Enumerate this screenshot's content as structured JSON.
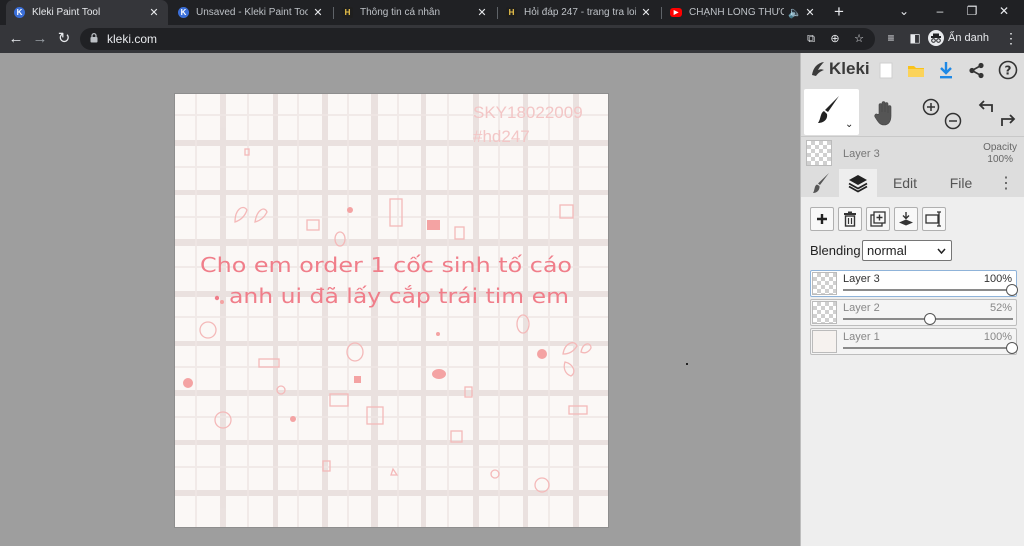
{
  "browser": {
    "tabs": [
      {
        "title": "Kleki Paint Tool",
        "active": true,
        "icon": "kleki-icon"
      },
      {
        "title": "Unsaved - Kleki Paint Tool",
        "active": false,
        "icon": "kleki-icon"
      },
      {
        "title": "Thông tin cá nhân",
        "active": false,
        "icon": "hoidap247-icon"
      },
      {
        "title": "Hỏi đáp 247 - trang tra loi",
        "active": false,
        "icon": "hoidap247-icon"
      },
      {
        "title": "CHẠNH LÒNG THƯƠNG",
        "active": false,
        "icon": "youtube-icon"
      }
    ],
    "url": "kleki.com",
    "profile_label": "Ẩn danh"
  },
  "canvas": {
    "watermark_line1": "SKY18022009",
    "watermark_line2": "#hd247",
    "text_line1": "Cho em order 1 cốc sinh tố cáo",
    "text_line2": "anh ui đã lấy cắp trái tim em"
  },
  "kleki": {
    "brand": "Kleki",
    "current_layer": {
      "name": "Layer 3",
      "opacity_label": "Opacity",
      "opacity_value": "100%"
    },
    "panel_tabs": [
      {
        "label": "",
        "icon": "brush-icon"
      },
      {
        "label": "",
        "icon": "layers-icon",
        "active": true
      },
      {
        "label": "Edit"
      },
      {
        "label": "File"
      }
    ],
    "blending_label": "Blending",
    "blending_value": "normal",
    "layers": [
      {
        "name": "Layer 3",
        "opacity": "100%",
        "value": 1.0,
        "active": true
      },
      {
        "name": "Layer 2",
        "opacity": "52%",
        "value": 0.52,
        "active": false
      },
      {
        "name": "Layer 1",
        "opacity": "100%",
        "value": 1.0,
        "active": false
      }
    ]
  },
  "colors": {
    "accent_pink": "#f07e8a",
    "grid_line": "#e6dbd9",
    "download_blue": "#1e88e5",
    "folder_yellow": "#f9c21a"
  }
}
